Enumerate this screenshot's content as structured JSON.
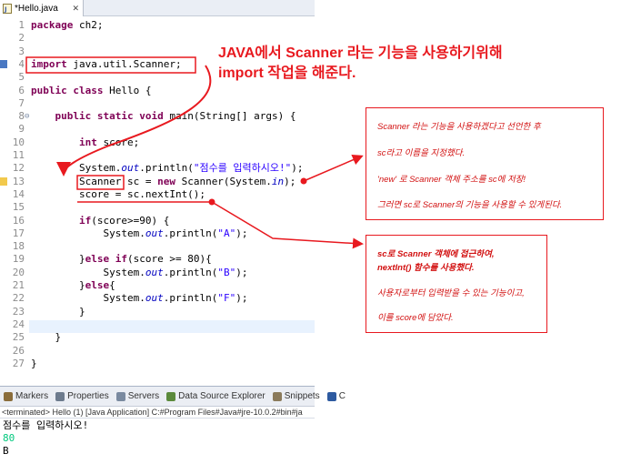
{
  "editor_tab": {
    "title": "*Hello.java"
  },
  "code_lines": [
    {
      "no": "1",
      "tokens": [
        {
          "t": "package",
          "c": "kw"
        },
        {
          "t": " ch2;",
          "c": ""
        }
      ]
    },
    {
      "no": "2",
      "tokens": []
    },
    {
      "no": "3",
      "tokens": []
    },
    {
      "no": "4",
      "tokens": [
        {
          "t": "import",
          "c": "kw"
        },
        {
          "t": " java.util.Scanner;",
          "c": ""
        }
      ]
    },
    {
      "no": "5",
      "tokens": []
    },
    {
      "no": "6",
      "tokens": [
        {
          "t": "public",
          "c": "kw"
        },
        {
          "t": " ",
          "c": ""
        },
        {
          "t": "class",
          "c": "kw"
        },
        {
          "t": " Hello {",
          "c": ""
        }
      ]
    },
    {
      "no": "7",
      "tokens": []
    },
    {
      "no": "8",
      "tokens": [
        {
          "t": "    ",
          "c": ""
        },
        {
          "t": "public",
          "c": "kw"
        },
        {
          "t": " ",
          "c": ""
        },
        {
          "t": "static",
          "c": "kw"
        },
        {
          "t": " ",
          "c": ""
        },
        {
          "t": "void",
          "c": "kw"
        },
        {
          "t": " main(String[] args) {",
          "c": ""
        }
      ]
    },
    {
      "no": "9",
      "tokens": []
    },
    {
      "no": "10",
      "tokens": [
        {
          "t": "        ",
          "c": ""
        },
        {
          "t": "int",
          "c": "kw"
        },
        {
          "t": " score;",
          "c": ""
        }
      ]
    },
    {
      "no": "11",
      "tokens": []
    },
    {
      "no": "12",
      "tokens": [
        {
          "t": "        System.",
          "c": ""
        },
        {
          "t": "out",
          "c": "fld"
        },
        {
          "t": ".println(",
          "c": ""
        },
        {
          "t": "\"점수를 입력하시오!\"",
          "c": "str"
        },
        {
          "t": ");",
          "c": ""
        }
      ]
    },
    {
      "no": "13",
      "tokens": [
        {
          "t": "        Scanner sc = ",
          "c": ""
        },
        {
          "t": "new",
          "c": "kw"
        },
        {
          "t": " Scanner(System.",
          "c": ""
        },
        {
          "t": "in",
          "c": "fld"
        },
        {
          "t": ");",
          "c": ""
        }
      ]
    },
    {
      "no": "14",
      "tokens": [
        {
          "t": "        score = sc.nextInt();",
          "c": ""
        }
      ]
    },
    {
      "no": "15",
      "tokens": []
    },
    {
      "no": "16",
      "tokens": [
        {
          "t": "        ",
          "c": ""
        },
        {
          "t": "if",
          "c": "kw"
        },
        {
          "t": "(score>=90) {",
          "c": ""
        }
      ]
    },
    {
      "no": "17",
      "tokens": [
        {
          "t": "            System.",
          "c": ""
        },
        {
          "t": "out",
          "c": "fld"
        },
        {
          "t": ".println(",
          "c": ""
        },
        {
          "t": "\"A\"",
          "c": "str"
        },
        {
          "t": ");",
          "c": ""
        }
      ]
    },
    {
      "no": "18",
      "tokens": []
    },
    {
      "no": "19",
      "tokens": [
        {
          "t": "        }",
          "c": ""
        },
        {
          "t": "else",
          "c": "kw"
        },
        {
          "t": " ",
          "c": ""
        },
        {
          "t": "if",
          "c": "kw"
        },
        {
          "t": "(score >= 80){",
          "c": ""
        }
      ]
    },
    {
      "no": "20",
      "tokens": [
        {
          "t": "            System.",
          "c": ""
        },
        {
          "t": "out",
          "c": "fld"
        },
        {
          "t": ".println(",
          "c": ""
        },
        {
          "t": "\"B\"",
          "c": "str"
        },
        {
          "t": ");",
          "c": ""
        }
      ]
    },
    {
      "no": "21",
      "tokens": [
        {
          "t": "        }",
          "c": ""
        },
        {
          "t": "else",
          "c": "kw"
        },
        {
          "t": "{",
          "c": ""
        }
      ]
    },
    {
      "no": "22",
      "tokens": [
        {
          "t": "            System.",
          "c": ""
        },
        {
          "t": "out",
          "c": "fld"
        },
        {
          "t": ".println(",
          "c": ""
        },
        {
          "t": "\"F\"",
          "c": "str"
        },
        {
          "t": ");",
          "c": ""
        }
      ]
    },
    {
      "no": "23",
      "tokens": [
        {
          "t": "        }",
          "c": ""
        }
      ]
    },
    {
      "no": "24",
      "tokens": []
    },
    {
      "no": "25",
      "tokens": [
        {
          "t": "    }",
          "c": ""
        }
      ]
    },
    {
      "no": "26",
      "tokens": []
    },
    {
      "no": "27",
      "tokens": [
        {
          "t": "}",
          "c": ""
        }
      ]
    }
  ],
  "views": [
    {
      "label": "Markers",
      "icon": "markers-icon",
      "color": "#8a6d3b"
    },
    {
      "label": "Properties",
      "icon": "properties-icon",
      "color": "#6d7b8d"
    },
    {
      "label": "Servers",
      "icon": "servers-icon",
      "color": "#7a8aa0"
    },
    {
      "label": "Data Source Explorer",
      "icon": "data-source-icon",
      "color": "#5b8a3c"
    },
    {
      "label": "Snippets",
      "icon": "snippets-icon",
      "color": "#8a7a5b"
    },
    {
      "label": "C",
      "icon": "console-icon",
      "color": "#2d5aa0"
    }
  ],
  "console": {
    "terminated": "<terminated> Hello (1) [Java Application] C:#Program Files#Java#jre-10.0.2#bin#ja",
    "output": [
      "점수를 입력하시오!",
      "80",
      "B"
    ],
    "input_color": "#00c87d"
  },
  "annotations": {
    "import_title": [
      "JAVA에서 Scanner 라는 기능을 사용하기위해",
      "import 작업을 해준다."
    ],
    "scanner_note": [
      "Scanner 라는 기능을 사용하겠다고 선언한 후",
      "sc라고 이름을 지정했다.",
      "'new' 로 Scanner 객체 주소를 sc에 저장!",
      "그러면 sc로 Scanner의 기능을 사용할 수 있게된다."
    ],
    "nextint_note": [
      "sc로 Scanner 객체에 접근하여,",
      "nextInt() 함수를 사용했다.",
      "사용자로부터 입력받을 수 있는 기능이고,",
      "이를 score에 담았다."
    ],
    "accent_color": "#e8191f"
  }
}
